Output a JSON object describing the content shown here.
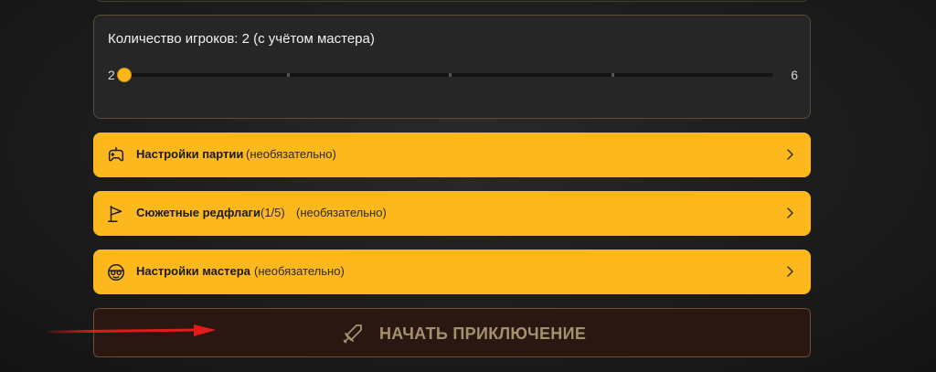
{
  "players": {
    "title": "Количество игроков: 2 (с учётом мастера)",
    "min_label": "2",
    "max_label": "6",
    "min": 2,
    "max": 6,
    "value": 2
  },
  "options": [
    {
      "title": "Настройки партии",
      "count": "",
      "optional": "(необязательно)",
      "icon": "gamepad-icon"
    },
    {
      "title": "Сюжетные редфлаги",
      "count": "(1/5)",
      "optional": "(необязательно)",
      "icon": "flag-icon"
    },
    {
      "title": "Настройки мастера",
      "count": "",
      "optional": "(необязательно)",
      "icon": "mask-icon"
    }
  ],
  "start_button": {
    "label": "НАЧАТЬ ПРИКЛЮЧЕНИЕ",
    "icon": "sword-icon"
  },
  "colors": {
    "accent": "#fcb81c",
    "start_bg": "#2a1712",
    "start_text": "#a3916c",
    "arrow": "#e21b1b"
  }
}
